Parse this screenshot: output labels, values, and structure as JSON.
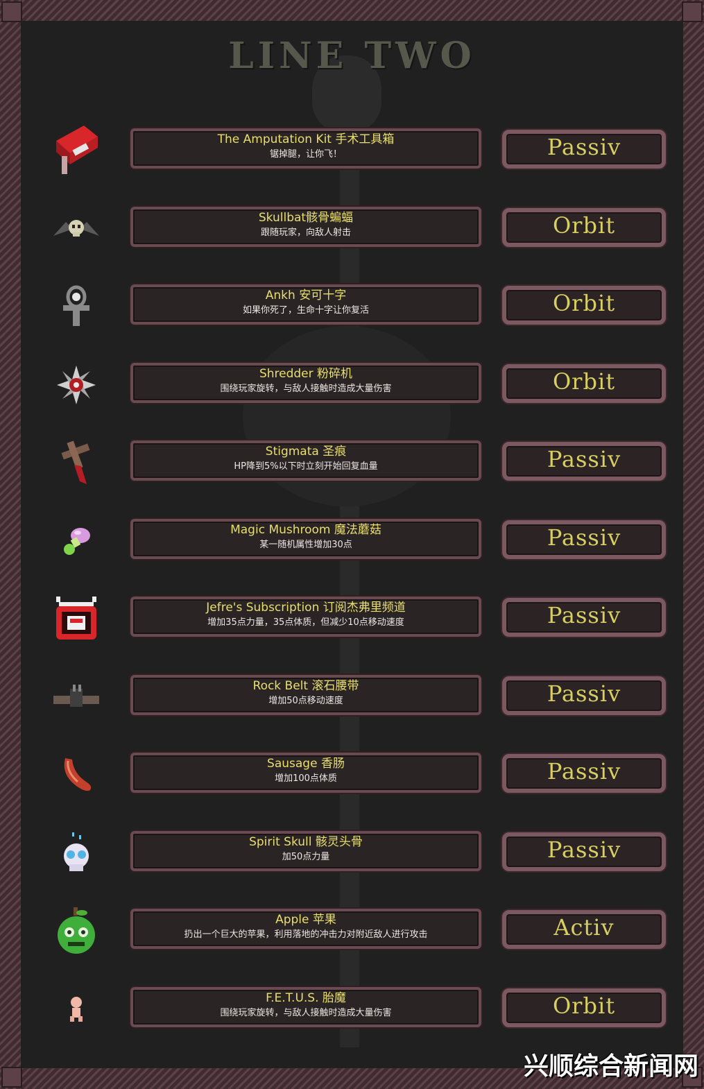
{
  "title": "LINE TWO",
  "items": [
    {
      "name": "The Amputation Kit 手术工具箱",
      "desc": "锯掉腿，让你飞！",
      "type": "Passiv",
      "icon": "amputation-kit-icon"
    },
    {
      "name": "Skullbat骸骨蝙蝠",
      "desc": "跟随玩家，向敌人射击",
      "type": "Orbit",
      "icon": "skullbat-icon"
    },
    {
      "name": "Ankh 安可十字",
      "desc": "如果你死了，生命十字让你复活",
      "type": "Orbit",
      "icon": "ankh-icon"
    },
    {
      "name": "Shredder 粉碎机",
      "desc": "围绕玩家旋转，与敌人接触时造成大量伤害",
      "type": "Orbit",
      "icon": "shredder-icon"
    },
    {
      "name": "Stigmata 圣痕",
      "desc": "HP降到5%以下时立刻开始回复血量",
      "type": "Passiv",
      "icon": "stigmata-icon"
    },
    {
      "name": "Magic Mushroom 魔法蘑菇",
      "desc": "某一随机属性增加30点",
      "type": "Passiv",
      "icon": "magic-mushroom-icon"
    },
    {
      "name": "Jefre's Subscription 订阅杰弗里频道",
      "desc": "增加35点力量，35点体质，但减少10点移动速度",
      "type": "Passiv",
      "icon": "tv-subscription-icon"
    },
    {
      "name": "Rock Belt 滚石腰带",
      "desc": "增加50点移动速度",
      "type": "Passiv",
      "icon": "rock-belt-icon"
    },
    {
      "name": "Sausage 香肠",
      "desc": "增加100点体质",
      "type": "Passiv",
      "icon": "sausage-icon"
    },
    {
      "name": "Spirit Skull 骸灵头骨",
      "desc": "加50点力量",
      "type": "Passiv",
      "icon": "spirit-skull-icon"
    },
    {
      "name": "Apple 苹果",
      "desc": "扔出一个巨大的苹果，利用落地的冲击力对附近敌人进行攻击",
      "type": "Activ",
      "icon": "apple-icon"
    },
    {
      "name": "F.E.T.U.S. 胎魔",
      "desc": "围绕玩家旋转，与敌人接触时造成大量伤害",
      "type": "Orbit",
      "icon": "fetus-icon"
    }
  ],
  "watermark": "兴顺综合新闻网"
}
